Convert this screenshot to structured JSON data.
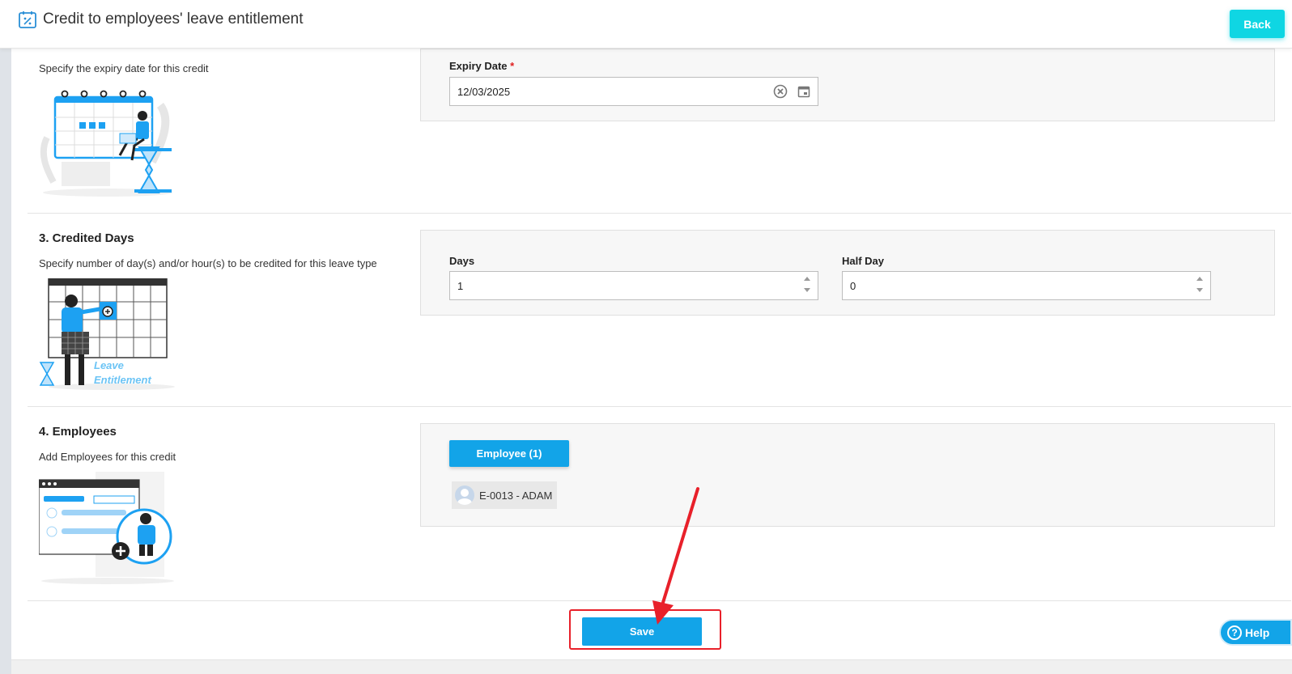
{
  "header": {
    "title": "Credit to employees' leave entitlement",
    "back_label": "Back"
  },
  "expiry": {
    "description": "Specify the expiry date for this credit",
    "label": "Expiry Date",
    "required_mark": "*",
    "value": "12/03/2025"
  },
  "credited_days": {
    "title": "3. Credited Days",
    "description": "Specify number of day(s) and/or hour(s) to be credited for this leave type",
    "illustration_text_1": "Leave",
    "illustration_text_2": "Entitlement",
    "days_label": "Days",
    "days_value": "1",
    "halfday_label": "Half Day",
    "halfday_value": "0"
  },
  "employees": {
    "title": "4. Employees",
    "description": "Add Employees for this credit",
    "button_label": "Employee (1)",
    "selected": [
      {
        "label": "E-0013 - ADAM"
      }
    ]
  },
  "footer": {
    "save_label": "Save",
    "help_label": "Help"
  },
  "colors": {
    "accent": "#12a4e8",
    "back_button": "#0fd6e3",
    "highlight": "#e8202a"
  }
}
